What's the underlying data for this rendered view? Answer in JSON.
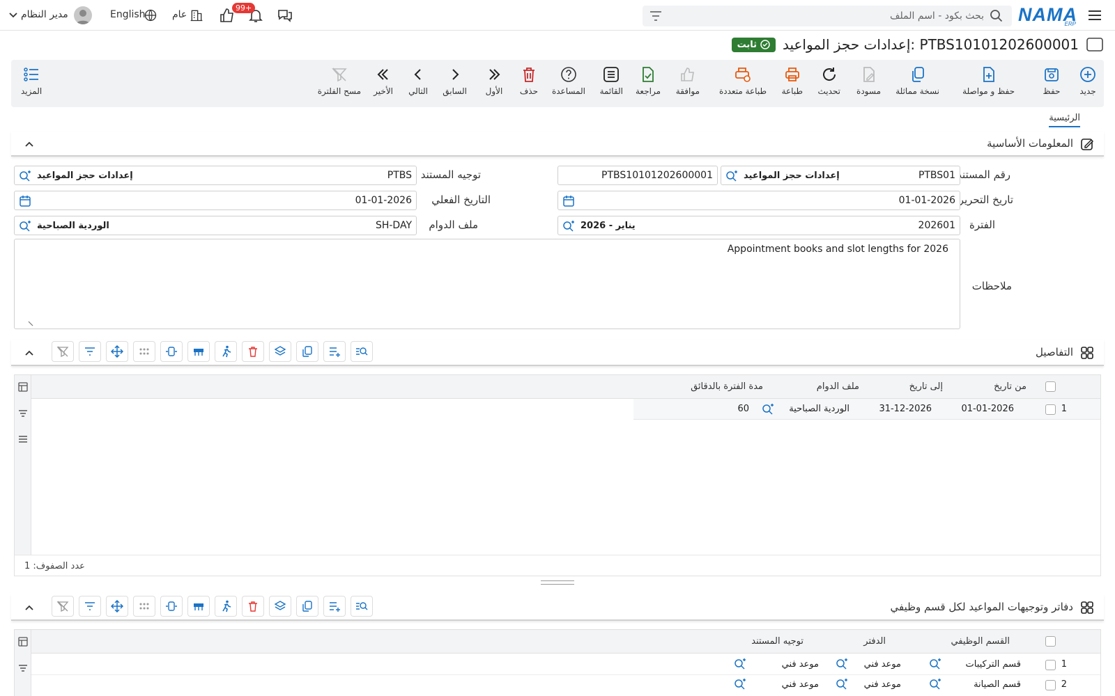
{
  "topbar": {
    "logo": "NAMA",
    "logo_sub": "ERP",
    "search_placeholder": "بحث بكود - اسم الملف",
    "notifications_badge": "99+",
    "company": "عام",
    "language": "English",
    "user": "مدير النظام"
  },
  "header": {
    "title": "إعدادات حجز المواعيد: PTBS10101202600001",
    "status": "ثابت"
  },
  "toolbar": {
    "new": "جديد",
    "save": "حفظ",
    "save_continue": "حفظ و مواصلة",
    "duplicate": "نسخة مماثلة",
    "draft": "مسودة",
    "refresh": "تحديث",
    "print": "طباعة",
    "multi_print": "طباعة متعددة",
    "approve": "موافقة",
    "review": "مراجعة",
    "list": "القائمة",
    "help": "المساعدة",
    "delete": "حذف",
    "first": "الأول",
    "previous": "السابق",
    "next": "التالي",
    "last": "الأخير",
    "clear_filter": "مسح الفلترة",
    "more": "المزيد"
  },
  "tabs": {
    "main": "الرئيسية"
  },
  "basic": {
    "section_title": "المعلومات الأساسية",
    "doc_number_label": "رقم المستند",
    "doc_number_code": "PTBS01",
    "doc_number_name": "إعدادات حجز المواعيد",
    "doc_number_value": "PTBS10101202600001",
    "direction_label": "توجيه المستند",
    "direction_code": "PTBS",
    "direction_name": "إعدادات حجز المواعيد",
    "edit_date_label": "تاريخ التحرير",
    "edit_date": "01-01-2026",
    "actual_date_label": "التاريخ الفعلي",
    "actual_date": "01-01-2026",
    "period_label": "الفترة",
    "period_code": "202601",
    "period_name": "2026 - يناير",
    "shift_label": "ملف الدوام",
    "shift_code": "SH-DAY",
    "shift_name": "الوردية الصباحية",
    "notes_label": "ملاحظات",
    "notes": "Appointment books and slot lengths for 2026"
  },
  "details": {
    "section_title": "التفاصيل",
    "columns": [
      "من تاريخ",
      "إلى تاريخ",
      "ملف الدوام",
      "مدة الفترة بالدقائق"
    ],
    "rows": [
      {
        "num": "1",
        "from": "01-01-2026",
        "to": "31-12-2026",
        "shift": "الوردية الصباحية",
        "minutes": "60"
      }
    ],
    "row_count": "عدد الصفوف: 1"
  },
  "books": {
    "section_title": "دفاتر وتوجيهات المواعيد لكل قسم وظيفي",
    "columns": [
      "القسم الوظيفي",
      "الدفتر",
      "توجيه المستند"
    ],
    "rows": [
      {
        "num": "1",
        "dept": "قسم التركيبات",
        "book": "موعد فني",
        "direction": "موعد فني"
      },
      {
        "num": "2",
        "dept": "قسم الصيانة",
        "book": "موعد فني",
        "direction": "موعد فني"
      }
    ]
  },
  "colors": {
    "accent": "#1a73c6",
    "status": "#2e7d32",
    "danger": "#e53935",
    "toolbar_bg": "#f1f2f4"
  }
}
